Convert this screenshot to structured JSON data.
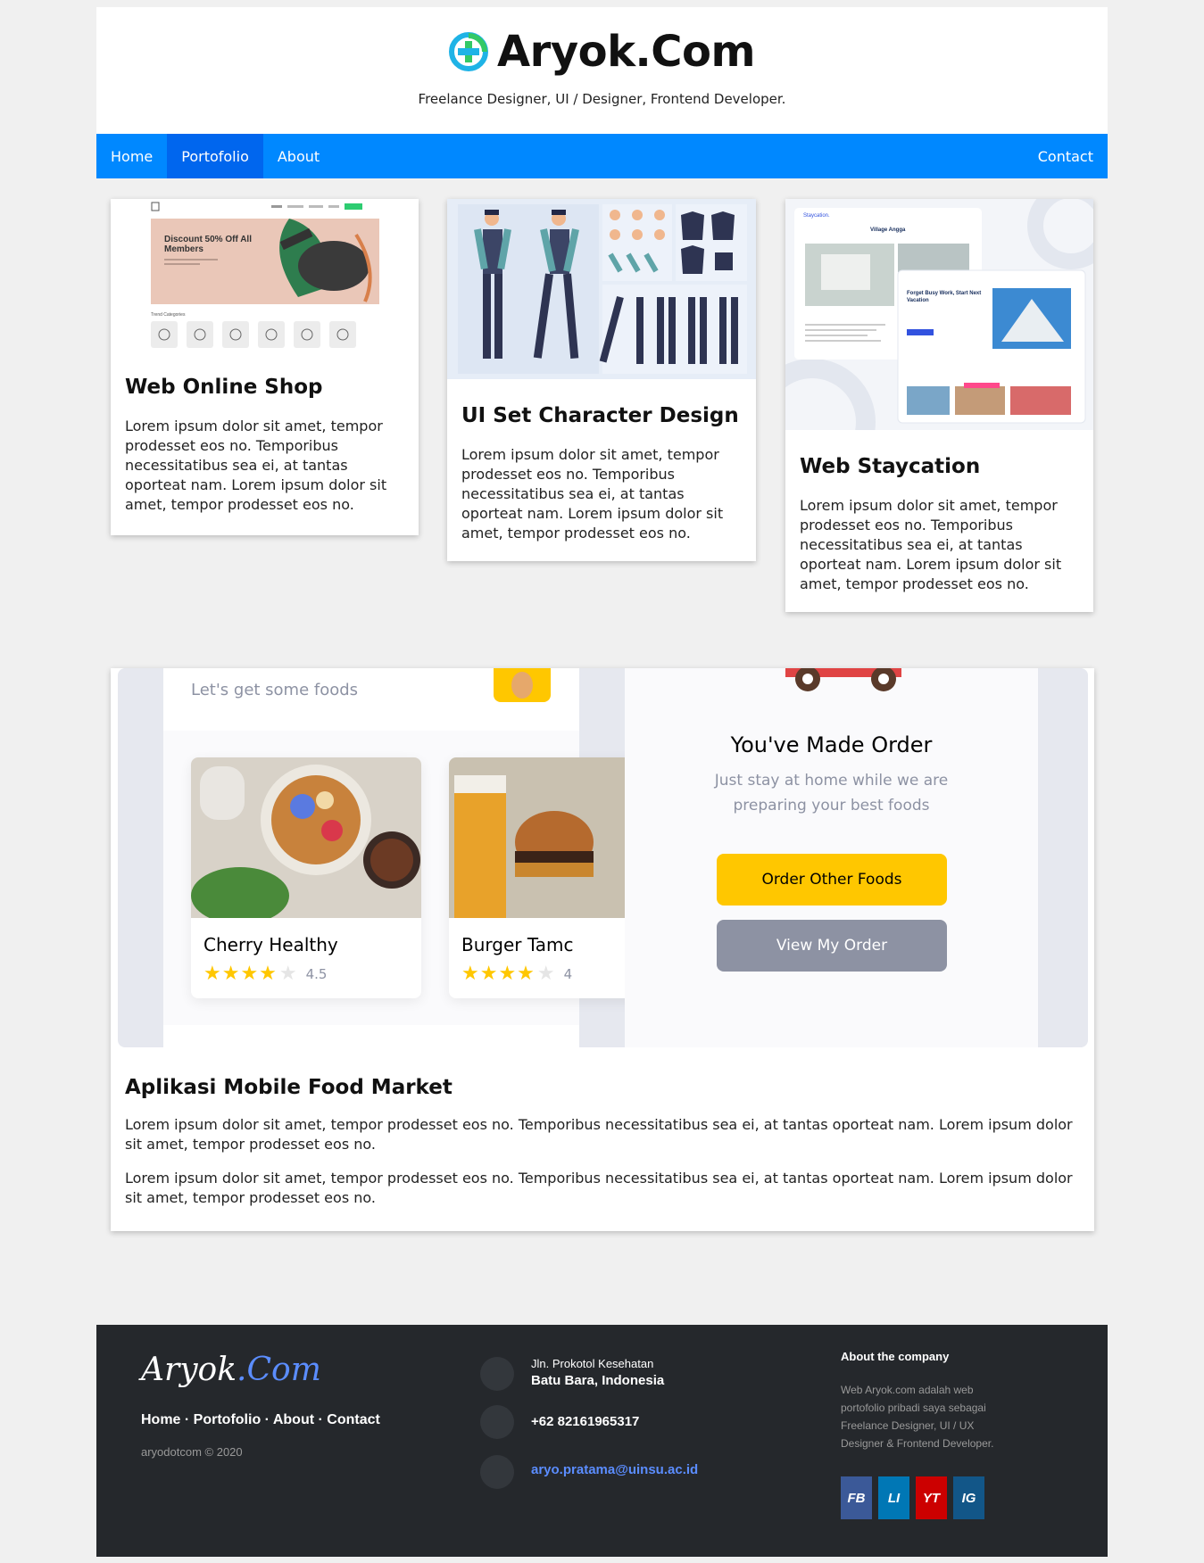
{
  "header": {
    "title": "Aryok.Com",
    "tagline": "Freelance Designer, UI / Designer, Frontend Developer."
  },
  "nav": {
    "home": "Home",
    "portfolio": "Portofolio",
    "about": "About",
    "contact": "Contact"
  },
  "cards": [
    {
      "title": "Web Online Shop",
      "text": "Lorem ipsum dolor sit amet, tempor prodesset eos no. Temporibus necessitatibus sea ei, at tantas oporteat nam. Lorem ipsum dolor sit amet, tempor prodesset eos no.",
      "shot": {
        "banner": "Discount 50% Off All Members",
        "section": "Trend Categories"
      }
    },
    {
      "title": "UI Set Character Design",
      "text": "Lorem ipsum dolor sit amet, tempor prodesset eos no. Temporibus necessitatibus sea ei, at tantas oporteat nam. Lorem ipsum dolor sit amet, tempor prodesset eos no."
    },
    {
      "title": "Web Staycation",
      "text": "Lorem ipsum dolor sit amet, tempor prodesset eos no. Temporibus necessitatibus sea ei, at tantas oporteat nam. Lorem ipsum dolor sit amet, tempor prodesset eos no.",
      "shot": {
        "brand": "Staycation.",
        "heading": "Village Angga",
        "hero": "Forget Busy Work, Start Next Vacation"
      }
    }
  ],
  "feature": {
    "title": "Aplikasi Mobile Food Market",
    "p1": "Lorem ipsum dolor sit amet, tempor prodesset eos no. Temporibus necessitatibus sea ei, at tantas oporteat nam. Lorem ipsum dolor sit amet, tempor prodesset eos no.",
    "p2": "Lorem ipsum dolor sit amet, tempor prodesset eos no. Temporibus necessitatibus sea ei, at tantas oporteat nam. Lorem ipsum dolor sit amet, tempor prodesset eos no.",
    "mock": {
      "greeting": "Let's get some foods",
      "food1": "Cherry Healthy",
      "rating1": "4.5",
      "food2": "Burger Tamc",
      "rating2": "4",
      "order_title": "You've Made Order",
      "order_sub1": "Just stay at home while we are",
      "order_sub2": "preparing your best foods",
      "order_btn": "Order Other Foods",
      "view_btn": "View My Order"
    }
  },
  "footer": {
    "logo_main": "Aryok",
    "logo_dot": ".Com",
    "links": [
      "Home",
      "Portofolio",
      "About",
      "Contact"
    ],
    "copyright": "aryodotcom © 2020",
    "address_line1": "Jln. Prokotol Kesehatan",
    "address_line2": "Batu Bara, Indonesia",
    "phone": "+62 82161965317",
    "email": "aryo.pratama@uinsu.ac.id",
    "about_title": "About the company",
    "about_text": "Web Aryok.com adalah web portofolio pribadi saya sebagai Freelance Designer, UI / UX Designer & Frontend Developer.",
    "socials": [
      {
        "label": "FB",
        "color": "#3b5998"
      },
      {
        "label": "LI",
        "color": "#0077b5"
      },
      {
        "label": "YT",
        "color": "#cc0000"
      },
      {
        "label": "IG",
        "color": "#125688"
      }
    ]
  },
  "colors": {
    "nav": "#0088ff",
    "nav_active": "#0066ee",
    "footer": "#25282c",
    "link": "#5b8dff",
    "order_btn": "#ffc700",
    "view_btn": "#8d92a3"
  }
}
